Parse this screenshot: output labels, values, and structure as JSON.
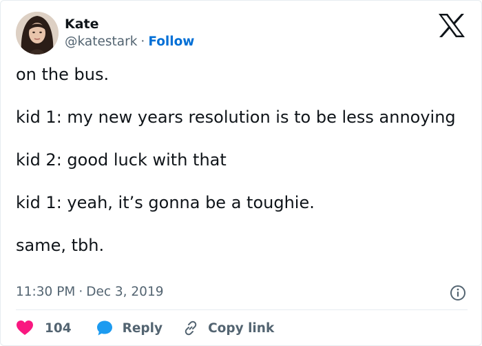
{
  "author": {
    "name": "Kate",
    "handle": "@katestark",
    "separator": "·",
    "follow_label": "Follow"
  },
  "tweet": {
    "paragraphs": [
      "on the bus.",
      "kid 1: my new years resolution is to be less annoying",
      "kid 2: good luck with that",
      "kid 1: yeah, it’s gonna be a toughie.",
      "same, tbh."
    ],
    "time": "11:30 PM",
    "separator": "·",
    "date": "Dec 3, 2019"
  },
  "actions": {
    "like_count": "104",
    "reply_label": "Reply",
    "copy_link_label": "Copy link"
  },
  "icons": {
    "brand": "x-logo-icon",
    "info": "info-icon",
    "like": "heart-icon",
    "reply": "speech-bubble-icon",
    "copy": "link-icon"
  },
  "colors": {
    "follow": "#006fd6",
    "heart": "#f91880",
    "reply_bubble": "#1d9bf0",
    "secondary_text": "#536471",
    "primary_text": "#0f1419"
  }
}
